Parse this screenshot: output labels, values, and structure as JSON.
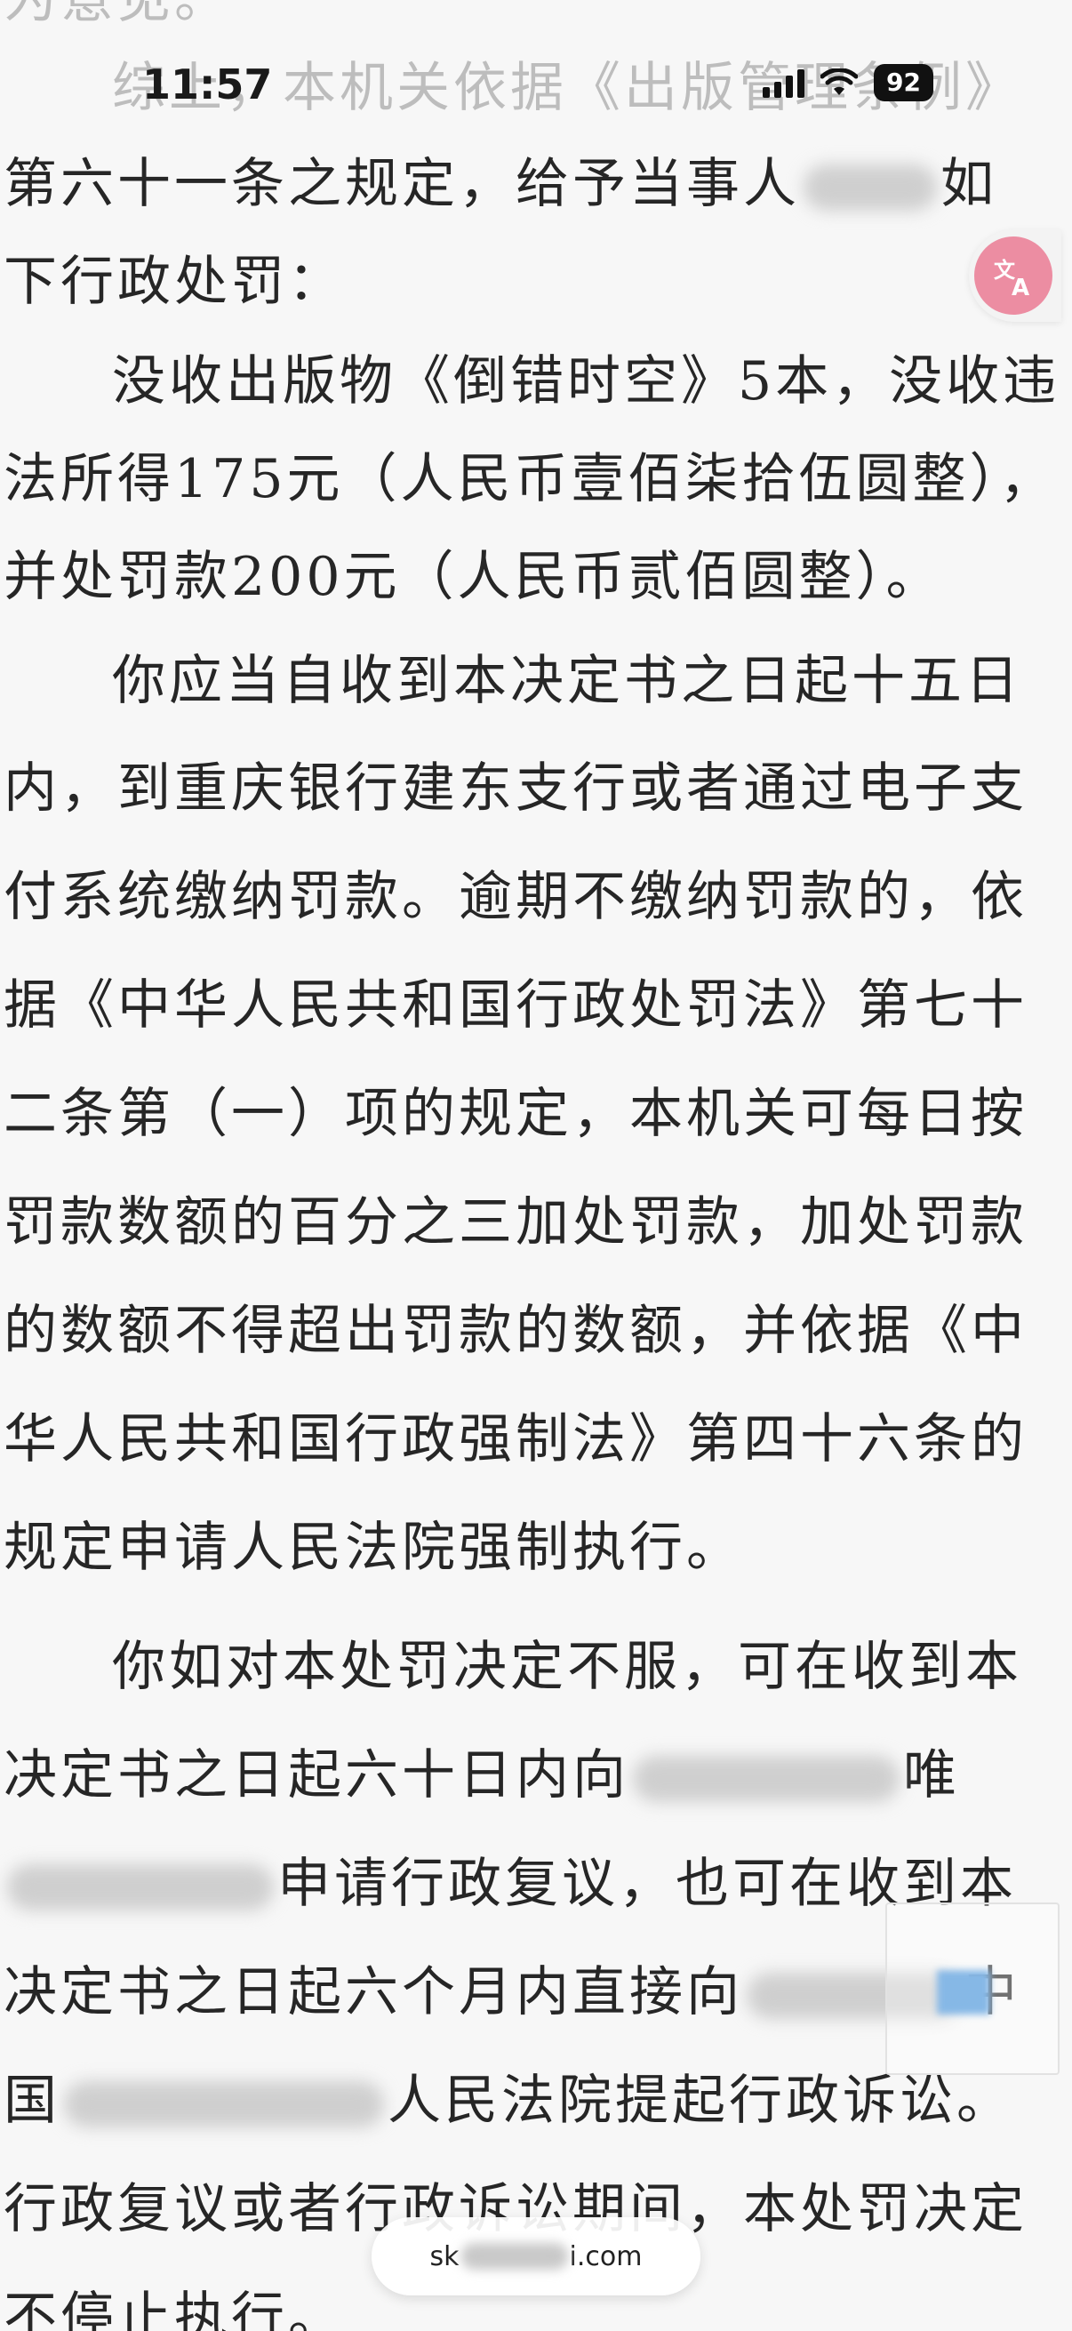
{
  "status_bar": {
    "time": "11:57",
    "battery": "92",
    "icons": [
      "signal-icon",
      "wifi-icon",
      "battery-icon"
    ]
  },
  "document": {
    "lines": [
      {
        "text": "为意见。",
        "faded": true
      },
      {
        "text": "综上，本机关依据《出版管理条例》",
        "faded": true
      },
      {
        "text": "第六十一条之规定，给予当事人",
        "after": "如"
      },
      {
        "text": "下行政处罚："
      },
      {
        "text": "没收出版物《倒错时空》5本，没收违"
      },
      {
        "text": "法所得175元（人民币壹佰柒拾伍圆整），"
      },
      {
        "text": "并处罚款200元（人民币贰佰圆整）。"
      },
      {
        "text": "你应当自收到本决定书之日起十五日"
      },
      {
        "text": "内，到重庆银行建东支行或者通过电子支"
      },
      {
        "text": "付系统缴纳罚款。逾期不缴纳罚款的，依"
      },
      {
        "text": "据《中华人民共和国行政处罚法》第七十"
      },
      {
        "text": "二条第（一）项的规定，本机关可每日按"
      },
      {
        "text": "罚款数额的百分之三加处罚款，加处罚款"
      },
      {
        "text": "的数额不得超出罚款的数额，并依据《中"
      },
      {
        "text": "华人民共和国行政强制法》第四十六条的"
      },
      {
        "text": "规定申请人民法院强制执行。"
      },
      {
        "text": "你如对本处罚决定不服，可在收到本"
      },
      {
        "text": "决定书之日起六十日内向",
        "after": "唯"
      },
      {
        "text": "",
        "after": "申请行政复议，也可在收到本"
      },
      {
        "text": "决定书之日起六个月内直接向",
        "after": "中"
      },
      {
        "text": "国",
        "after": "人民法院提起行政诉讼。"
      },
      {
        "text": "行政复议或者行政诉讼期间，本处罚决定"
      },
      {
        "text": "不停止执行。"
      }
    ]
  },
  "url_bar": {
    "prefix": "sk",
    "suffix": "i.com"
  },
  "colors": {
    "background": "#f7f7f7",
    "text": "#262626",
    "translate_accent": "#ec8da2"
  }
}
